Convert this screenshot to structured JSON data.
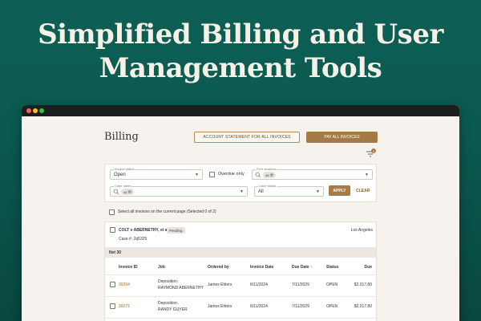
{
  "hero": {
    "line1": "Simplified Billing and User",
    "line2": "Management Tools"
  },
  "page": {
    "title": "Billing",
    "account_statement_label": "ACCOUNT STATEMENT FOR ALL INVOICES",
    "pay_all_label": "PAY ALL INVOICES",
    "filter_badge_count": "1"
  },
  "filters": {
    "invoice_status": {
      "label": "Invoice status",
      "value": "Open"
    },
    "overdue_only": {
      "label": "Overdue only",
      "checked": false
    },
    "firm_locations": {
      "label": "Firm locations",
      "chip": "All"
    },
    "case_name": {
      "label": "Case name",
      "chip": "All"
    },
    "case_status": {
      "label": "Case status",
      "value": "All"
    },
    "apply_label": "APPLY",
    "clear_label": "CLEAR"
  },
  "select_all": {
    "label": "Select all invoices on the current page",
    "count_text": "(Selected 0 of 2)"
  },
  "case_card": {
    "case_title": "COLT v ABERNETHY, et al.",
    "status_badge": "Pending",
    "location": "Los Angeles",
    "case_number": "Case #: 2q5325",
    "group_label": "Net 30",
    "columns": [
      "Invoice ID",
      "Job",
      "Ordered by",
      "Invoice Date",
      "Due Date",
      "Status",
      "Due"
    ],
    "sort_indicator": "↑",
    "rows": [
      {
        "invoice_id": "39264",
        "job_line1": "Deposition:",
        "job_line2": "RAYMOND ABERNETHY",
        "ordered_by": "James Ehlers",
        "invoice_date": "6/11/2024",
        "due_date": "7/11/2029",
        "status": "OPEN",
        "due": "$2,017.80"
      },
      {
        "invoice_id": "39271",
        "job_line1": "Deposition:",
        "job_line2": "RANDY GUYER",
        "ordered_by": "James Ehlers",
        "invoice_date": "6/11/2024",
        "due_date": "7/11/2029",
        "status": "OPEN",
        "due": "$2,017.80"
      }
    ]
  },
  "colors": {
    "background": "#0b5a50",
    "accent": "#a67a44",
    "window": "#f6f3ee"
  }
}
